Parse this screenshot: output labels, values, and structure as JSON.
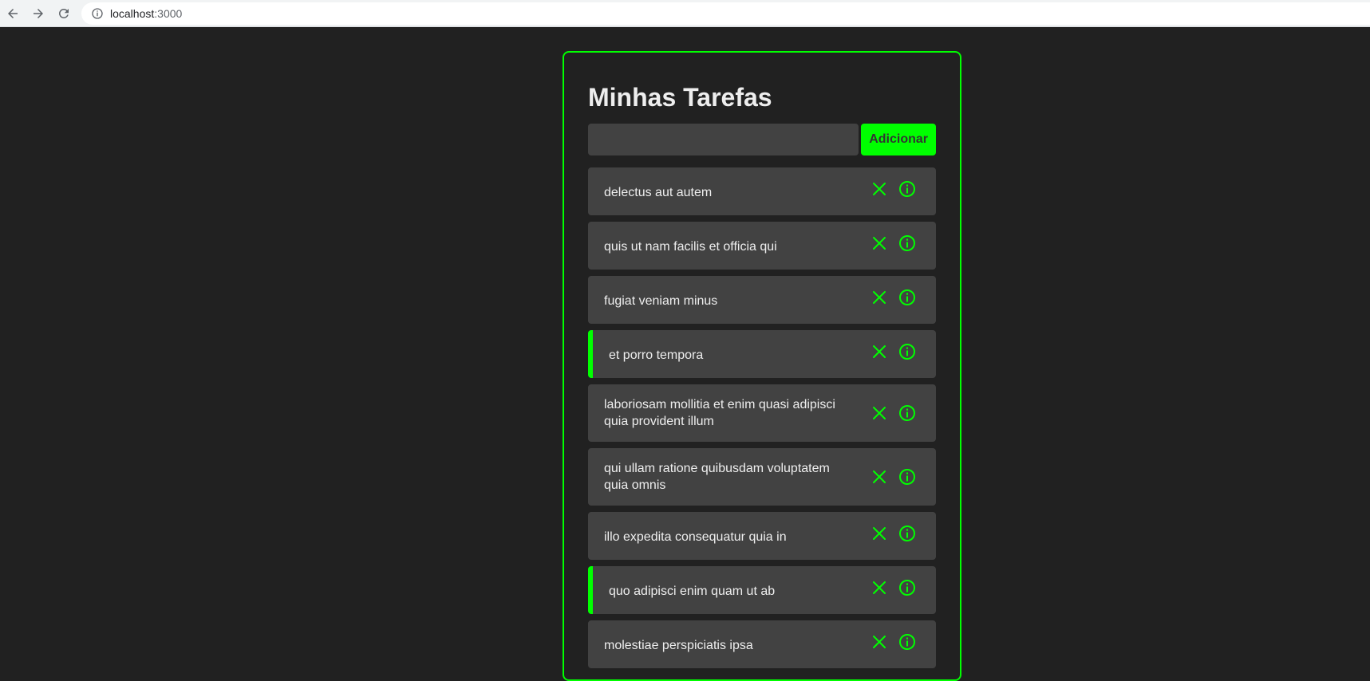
{
  "browser": {
    "url_host": "localhost",
    "url_port": ":3000"
  },
  "app": {
    "title": "Minhas Tarefas",
    "input_value": "",
    "add_label": "Adicionar",
    "accent_color": "#00ff00"
  },
  "tasks": [
    {
      "label": "delectus aut autem",
      "completed": false
    },
    {
      "label": "quis ut nam facilis et officia qui",
      "completed": false
    },
    {
      "label": "fugiat veniam minus",
      "completed": false
    },
    {
      "label": "et porro tempora",
      "completed": true
    },
    {
      "label": "laboriosam mollitia et enim quasi adipisci quia provident illum",
      "completed": false
    },
    {
      "label": "qui ullam ratione quibusdam voluptatem quia omnis",
      "completed": false
    },
    {
      "label": "illo expedita consequatur quia in",
      "completed": false
    },
    {
      "label": "quo adipisci enim quam ut ab",
      "completed": true
    },
    {
      "label": "molestiae perspiciatis ipsa",
      "completed": false
    }
  ]
}
